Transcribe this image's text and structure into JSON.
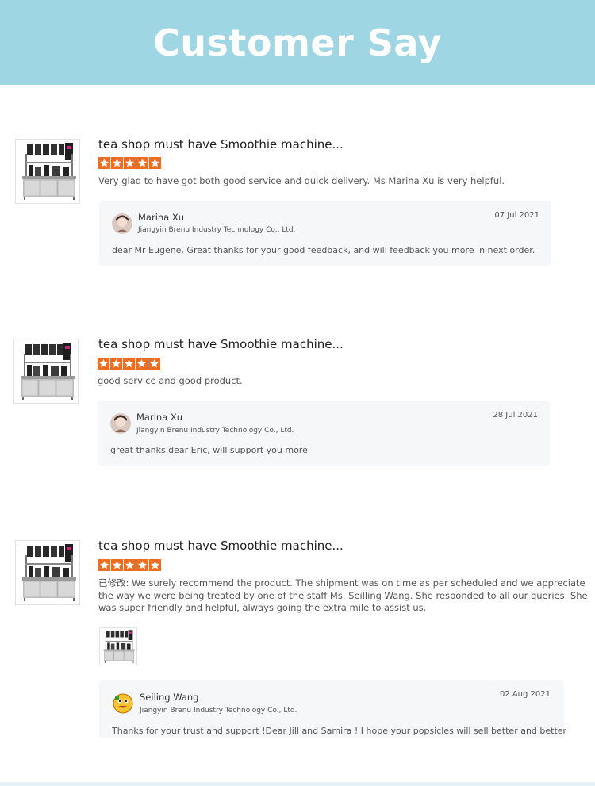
{
  "header": {
    "title": "Customer Say"
  },
  "reviews": [
    {
      "title": "tea shop must have Smoothie machine...",
      "rating": 5,
      "text": "Very glad to have got both good service and quick delivery. Ms Marina Xu is very helpful.",
      "product_image": "tea-shop-counter-image",
      "reply": {
        "name": "Marina Xu",
        "company": "Jiangyin Brenu Industry Technology Co., Ltd.",
        "date": "07 Jul 2021",
        "text": "dear Mr Eugene, Great thanks for your good feedback, and will feedback you more in next order."
      }
    },
    {
      "title": "tea shop must have Smoothie machine...",
      "rating": 5,
      "text": "good service and good product.",
      "product_image": "tea-shop-counter-image",
      "reply": {
        "name": "Marina Xu",
        "company": "Jiangyin Brenu Industry Technology Co., Ltd.",
        "date": "28 Jul 2021",
        "text": "great thanks dear Eric, will support you more"
      }
    },
    {
      "title": "tea shop must have Smoothie machine...",
      "rating": 5,
      "text_line1": "已修改: We surely recommend the product. The shipment was on time as per scheduled and we appreciate",
      "text_line2": "the way we were being treated by one of the staff Ms. Seilling Wang. She responded to all our queries. She",
      "text_line3": "was super friendly and helpful, always going the extra mile to assist us.",
      "product_image": "tea-shop-counter-image",
      "photo": "tea-shop-counter-photo",
      "reply": {
        "name": "Seiling Wang",
        "company": "Jiangyin Brenu Industry Technology Co., Ltd.",
        "date": "02 Aug 2021",
        "text": "Thanks for your trust and support !Dear Jill and Samira ! I hope your popsicles will sell better and better"
      }
    }
  ],
  "colors": {
    "header_bg": "#9ed6e3",
    "star": "#f26b1d",
    "reply_bg": "#f6f7f9"
  }
}
